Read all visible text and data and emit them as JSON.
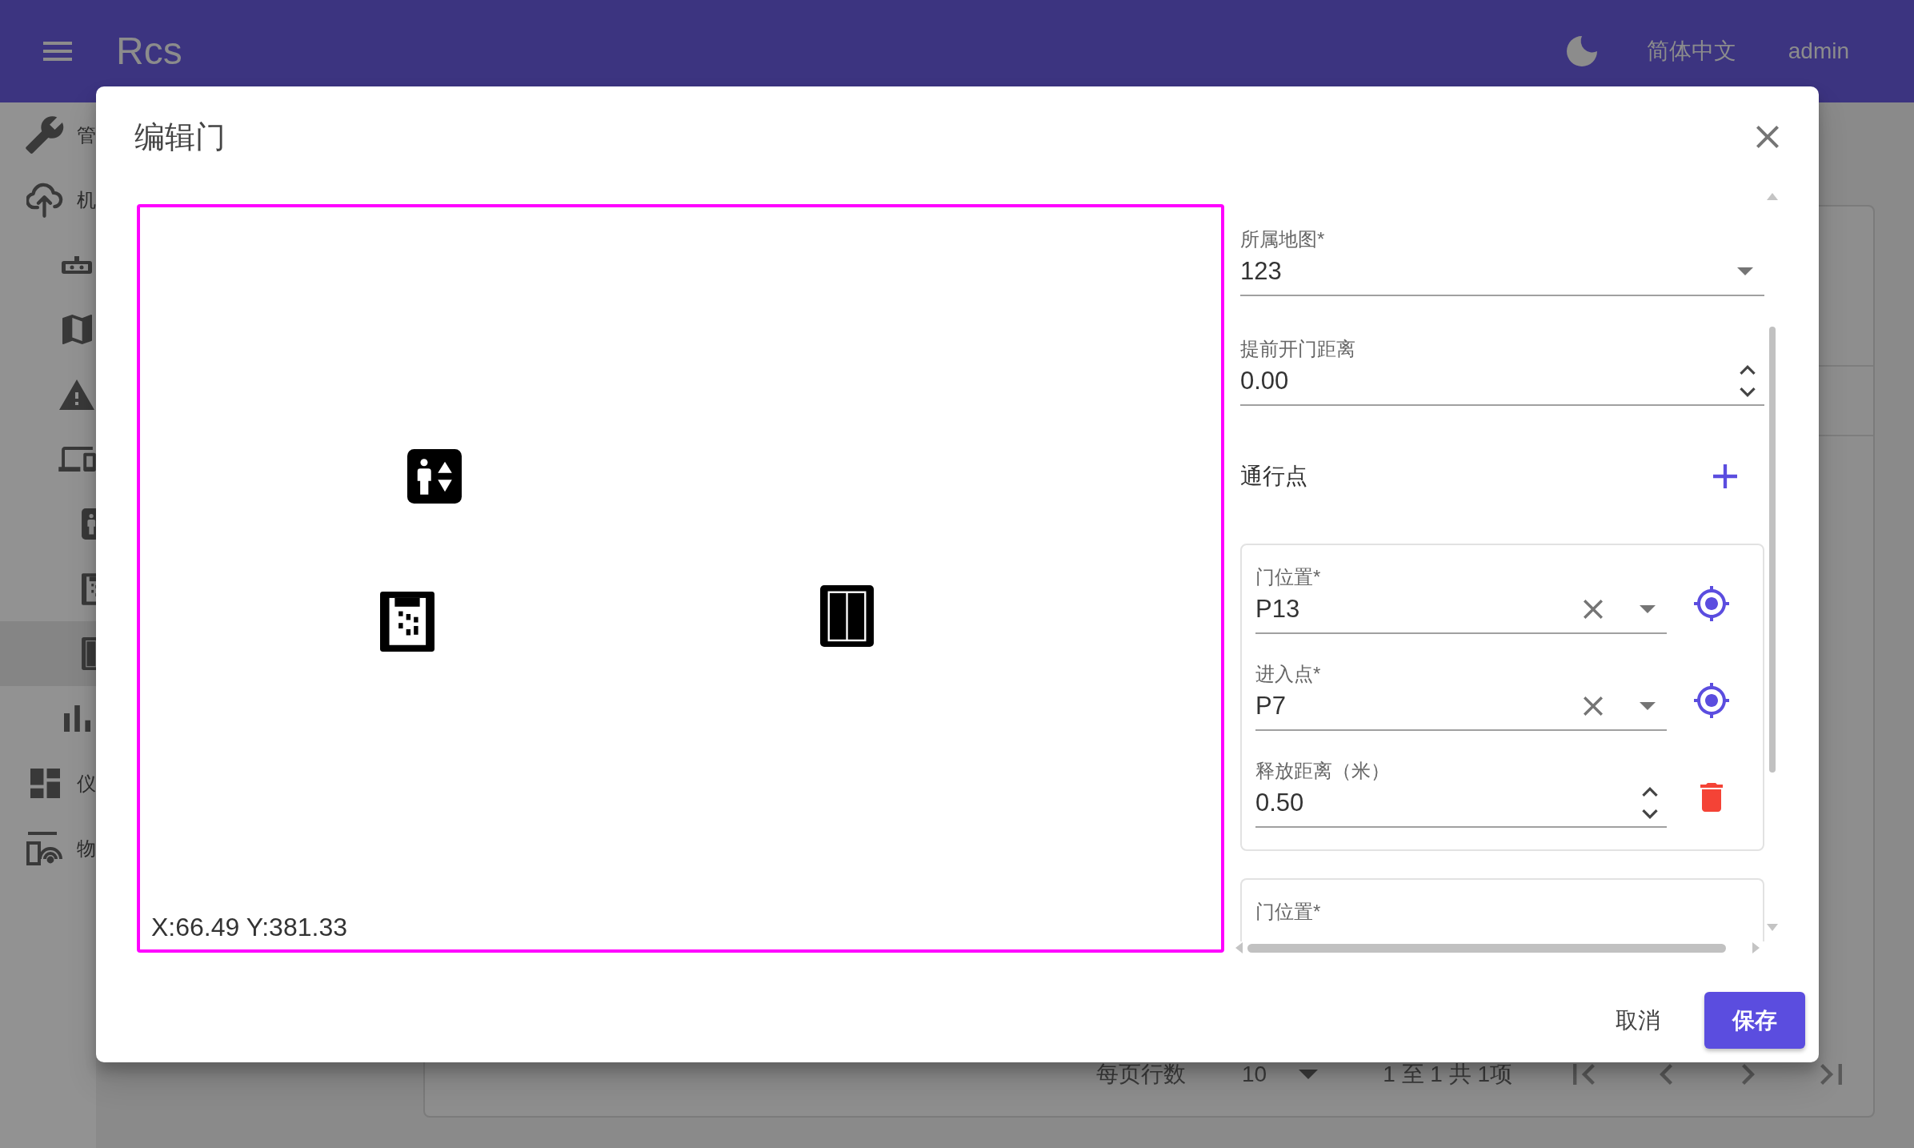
{
  "app_bar": {
    "title": "Rcs",
    "language": "简体中文",
    "user": "admin"
  },
  "sidebar": {
    "items": [
      {
        "label": "管",
        "selected": false
      },
      {
        "label": "机",
        "selected": false,
        "children": [
          {
            "selected": false
          },
          {
            "selected": false
          },
          {
            "selected": false
          },
          {
            "selected": false,
            "children": [
              {
                "selected": false
              },
              {
                "selected": false
              },
              {
                "selected": true
              }
            ]
          },
          {
            "selected": false
          }
        ]
      },
      {
        "label": "仪",
        "selected": false
      },
      {
        "label": "物",
        "selected": false
      }
    ]
  },
  "table": {
    "pagination": {
      "rows_per_page_label": "每页行数",
      "rows_per_page": "10",
      "range": "1 至 1 共 1项"
    }
  },
  "dialog": {
    "title": "编辑门",
    "map": {
      "coordinates": "X:66.49 Y:381.33"
    },
    "form": {
      "map_select": {
        "label": "所属地图*",
        "value": "123"
      },
      "open_distance": {
        "label": "提前开门距离",
        "value": "0.00"
      },
      "pass_points": {
        "title": "通行点",
        "entries": [
          {
            "door_position": {
              "label": "门位置*",
              "value": "P13"
            },
            "entry_point": {
              "label": "进入点*",
              "value": "P7"
            },
            "release_distance": {
              "label": "释放距离（米）",
              "value": "0.50"
            }
          },
          {
            "door_position": {
              "label": "门位置*"
            }
          }
        ]
      }
    },
    "buttons": [
      {
        "label": "取消",
        "kind": "text"
      },
      {
        "label": "保存",
        "kind": "primary"
      }
    ]
  }
}
